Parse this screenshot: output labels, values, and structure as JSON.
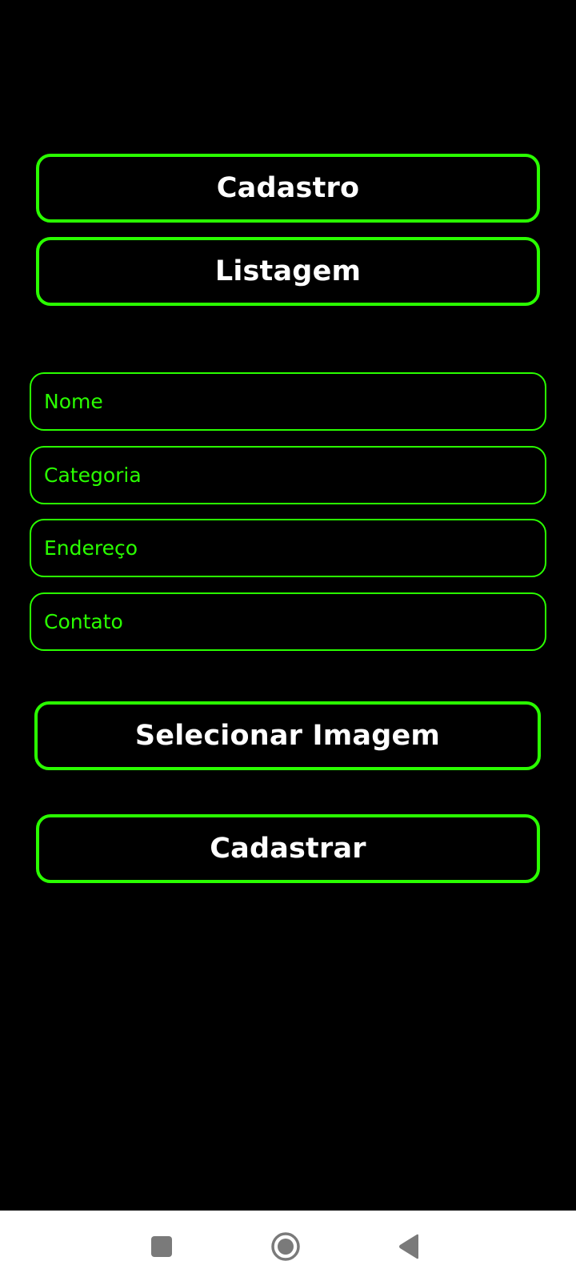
{
  "colors": {
    "background": "#000000",
    "accent": "#2aff00",
    "button_text": "#ffffff",
    "navbar": "#ffffff",
    "nav_icon": "#7a7a7a"
  },
  "top_buttons": {
    "cadastro_label": "Cadastro",
    "listagem_label": "Listagem"
  },
  "form": {
    "nome_placeholder": "Nome",
    "categoria_placeholder": "Categoria",
    "endereco_placeholder": "Endereço",
    "contato_placeholder": "Contato",
    "nome_value": "",
    "categoria_value": "",
    "endereco_value": "",
    "contato_value": ""
  },
  "actions": {
    "select_image_label": "Selecionar Imagem",
    "submit_label": "Cadastrar"
  },
  "system_nav": {
    "recents_icon": "square-icon",
    "home_icon": "circle-icon",
    "back_icon": "triangle-back-icon"
  }
}
